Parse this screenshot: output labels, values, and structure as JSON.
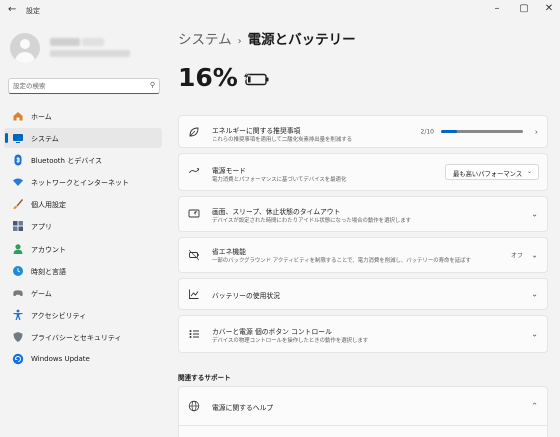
{
  "window": {
    "title": "設定",
    "back_glyph": "←",
    "minimize_glyph": "–",
    "maximize_glyph": "▢",
    "close_glyph": "✕"
  },
  "sidebar": {
    "search_placeholder": "設定の検索",
    "items": [
      {
        "label": "ホーム",
        "icon": "home-icon",
        "color": "#d9822b"
      },
      {
        "label": "システム",
        "icon": "system-icon",
        "color": "#0067c0",
        "active": true
      },
      {
        "label": "Bluetooth とデバイス",
        "icon": "bluetooth-icon",
        "color": "#1f6fd6"
      },
      {
        "label": "ネットワークとインターネット",
        "icon": "wifi-icon",
        "color": "#2a7ad8"
      },
      {
        "label": "個人用設定",
        "icon": "brush-icon",
        "color": "#e08a2e"
      },
      {
        "label": "アプリ",
        "icon": "apps-icon",
        "color": "#4a5a78"
      },
      {
        "label": "アカウント",
        "icon": "account-icon",
        "color": "#2fa05a"
      },
      {
        "label": "時刻と言語",
        "icon": "clock-globe-icon",
        "color": "#1f8ad6"
      },
      {
        "label": "ゲーム",
        "icon": "gamepad-icon",
        "color": "#7a7a7a"
      },
      {
        "label": "アクセシビリティ",
        "icon": "accessibility-icon",
        "color": "#1a73d0"
      },
      {
        "label": "プライバシーとセキュリティ",
        "icon": "shield-icon",
        "color": "#707a86"
      },
      {
        "label": "Windows Update",
        "icon": "update-icon",
        "color": "#1570d8"
      }
    ]
  },
  "main": {
    "breadcrumb_parent": "システム",
    "breadcrumb_sep": "›",
    "breadcrumb_current": "電源とバッテリー",
    "battery_percent": "16%",
    "battery_level": 0.16,
    "accent_color": "#0067c0",
    "cards": {
      "energy": {
        "title": "エネルギーに関する推奨事項",
        "desc": "これらの推奨事項を適用して二酸化炭素排出量を削減する",
        "progress_text": "2/10",
        "progress_value": 0.2,
        "icon": "leaf-icon"
      },
      "power_mode": {
        "title": "電源モード",
        "desc": "電力消費とパフォーマンスに基づいてデバイスを最適化",
        "value": "最も高いパフォーマンス",
        "icon": "power-mode-icon"
      },
      "screen_sleep": {
        "title": "画面、スリープ、休止状態のタイムアウト",
        "desc": "デバイスが設定された時間にわたりアイドル状態になった場合の動作を選択します",
        "icon": "screen-sleep-icon"
      },
      "saver": {
        "title": "省エネ機能",
        "desc": "一部のバックグラウンド アクティビティを制限することで、電力消費を削減し、バッテリーの寿命を延ばす",
        "state": "オフ",
        "icon": "battery-saver-icon"
      },
      "usage": {
        "title": "バッテリーの使用状況",
        "icon": "chart-icon"
      },
      "lid": {
        "title": "カバーと電源 個のボタン コントロール",
        "desc": "デバイスの物理コントロールを操作したときの動作を選択します",
        "icon": "lid-buttons-icon"
      }
    },
    "related_title": "関連するサポート",
    "help_card": {
      "title": "電源に関するヘルプ",
      "icon": "globe-icon"
    }
  }
}
